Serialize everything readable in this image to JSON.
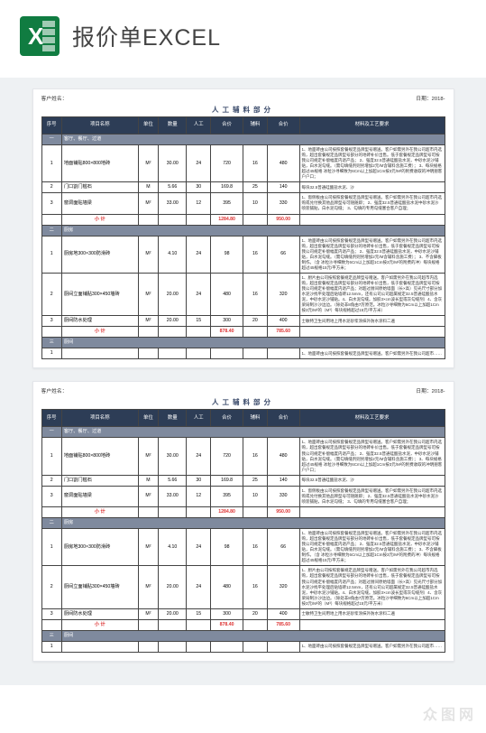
{
  "header": {
    "title": "报价单EXCEL"
  },
  "meta": {
    "client_label": "客户姓名：",
    "date_label": "日期：2018-",
    "section_title": "人工辅料部分"
  },
  "cols": [
    "序号",
    "项目名称",
    "单位",
    "数量",
    "人工",
    "合价",
    "辅料",
    "合价",
    "材料及工艺要求"
  ],
  "sections": [
    {
      "no": "一",
      "title": "客厅、餐厅、过道"
    },
    {
      "no": "二",
      "title": "厨房"
    },
    {
      "no": "三",
      "title": "厨间"
    }
  ],
  "rows_a": [
    {
      "n": "1",
      "name": "地面铺贴800×800地砖",
      "u": "M²",
      "qty": "30.00",
      "lab": "24",
      "lp": "720",
      "mat": "16",
      "mp": "480",
      "req": "1、地面砖由公司按照套餐规定品牌型号赠送。客户如需另外在我公司超市内选购，超出套餐规定品牌型号部分的地砖补价出售。低于套餐规定品牌型号可按我公司规定补偿幅度内退产品；\n2、强度32.5普通硅酸盐水泥，中砂水泥沙铺贴，白水泥勾缝。（需勾填缝剂则另增加2元/M含辅料含施工费）；\n3、每块规格超过45规格 冰粒沙寻细致为6Cm以上加超1Cm按3元/M²的附费收取的冲明朋客户户口；"
    },
    {
      "n": "2",
      "name": "门口割门槛石",
      "u": "M",
      "qty": "5.66",
      "lab": "30",
      "lp": "169.8",
      "mat": "25",
      "mp": "140",
      "req": "每块32.5普通硅酸盐水泥、沙"
    },
    {
      "n": "3",
      "name": "窗洞面贴墙梁",
      "u": "M²",
      "qty": "33.00",
      "lab": "12",
      "lp": "395",
      "mat": "10",
      "mp": "330",
      "req": "1、窗侧板由公司按照套餐规定品牌型号赠送。客户如需另外在我公司超市内选购或兑付换其他品牌型号可随随即；\n2、强度32.5普通硅酸盐水泥中砂水泥沙喷装铺贴，白水泥勾缝；\n3、勾填的专用勾缝塞合客户自理；"
    }
  ],
  "subtotal_a": {
    "label": "小 计",
    "lp": "1284.80",
    "mp": "950.00"
  },
  "rows_b": [
    {
      "n": "1",
      "name": "厨房地300×300防滑砖",
      "u": "M²",
      "qty": "4.10",
      "lab": "24",
      "lp": "98",
      "mat": "16",
      "mp": "66",
      "req": "1、地面砖由公司按照套餐规定品牌型号赠送。客户如需另外在我公司超市内选购，超出套餐规定品牌型号部分的地砖补价出售，低于套餐规定品牌型号可按我公司规定补偿幅度内退产品；\n2、强度32.5普通硅酸盐水泥，中砂水泥沙铺贴，白水泥勾缝。（需勾填缝剂则另增加2元/M含辅料含施工费）；\n3、不含脚板制作。（含 冰粒沙寻细致为6Cm以上加超1Cm按3元/M²的附费的冲）每块规格超过45规格15元/平方米；"
    },
    {
      "n": "2",
      "name": "厨间立面铺贴300×450墙砖",
      "u": "M²",
      "qty": "20.00",
      "lab": "24",
      "lp": "480",
      "mat": "16",
      "mp": "320",
      "req": "1、厨片由公司按照套餐规定品牌型号赠送。客户如需另外在我公司超市内选购，超出套餐规定品牌型号部分的地砖补价出售，低于套餐规定品牌型号可按我公司规定补偿幅度内退产品；对超过厨间原始墙面（长×高）见光尺寸部分加水泥沙找平处理后贴墙砖12.5mm，还有公司公司超属规定32.5普通硅酸盐水泥，中砂水泥沙铺贴。4、白水泥勾缝。加胶3×cm波长型或灰勾缝剂）4、含灰梁局制沙沙边边。（除处非8角由7厉原范。冰粒沙寻细致为6Cm以上加超1Cm按3元/M²的（M³）每块规格超过15元/平方米）"
    },
    {
      "n": "3",
      "name": "厨间防水处理",
      "u": "M²",
      "qty": "20.00",
      "lab": "15",
      "lp": "300",
      "mat": "20",
      "mp": "400",
      "req": "士敏特卫生间用地上用水泥砂浆涂抹外防水涂料二遍"
    }
  ],
  "subtotal_b": {
    "label": "小 计",
    "lp": "878.40",
    "mp": "785.60"
  },
  "rows_c": [
    {
      "n": "1",
      "name": "",
      "u": "",
      "qty": "",
      "lab": "",
      "lp": "",
      "mat": "",
      "mp": "",
      "req": "1、地面砖由公司按照套餐规定品牌型号赠送。客户如需另外在我公司超市……"
    }
  ],
  "watermark": "众图网"
}
